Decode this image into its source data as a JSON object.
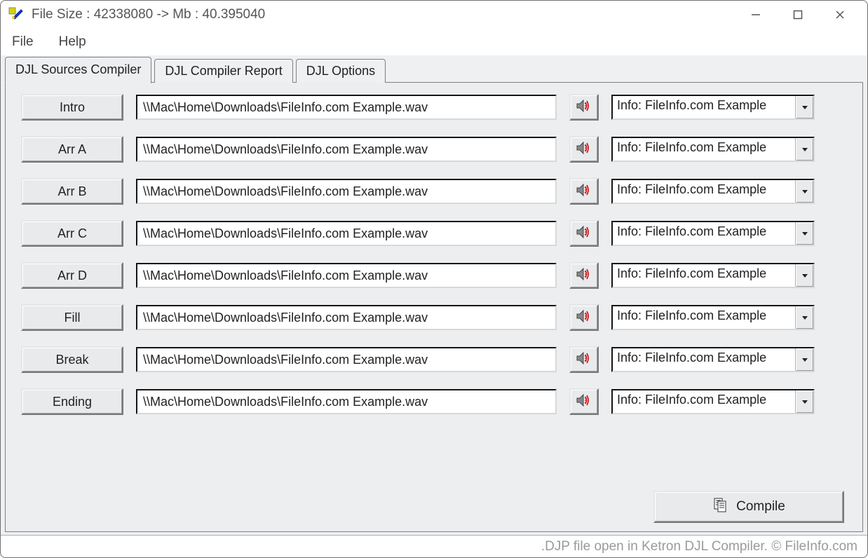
{
  "titlebar": {
    "title": "File Size : 42338080 -> Mb : 40.395040"
  },
  "menu": {
    "file": "File",
    "help": "Help"
  },
  "tabs": [
    {
      "label": "DJL Sources Compiler",
      "active": true
    },
    {
      "label": "DJL Compiler Report",
      "active": false
    },
    {
      "label": "DJL Options",
      "active": false
    }
  ],
  "rows": [
    {
      "key": "intro",
      "label": "Intro",
      "path": "\\\\Mac\\Home\\Downloads\\FileInfo.com Example.wav",
      "info": "Info: FileInfo.com Example"
    },
    {
      "key": "arr-a",
      "label": "Arr A",
      "path": "\\\\Mac\\Home\\Downloads\\FileInfo.com Example.wav",
      "info": "Info: FileInfo.com Example"
    },
    {
      "key": "arr-b",
      "label": "Arr B",
      "path": "\\\\Mac\\Home\\Downloads\\FileInfo.com Example.wav",
      "info": "Info: FileInfo.com Example"
    },
    {
      "key": "arr-c",
      "label": "Arr C",
      "path": "\\\\Mac\\Home\\Downloads\\FileInfo.com Example.wav",
      "info": "Info: FileInfo.com Example"
    },
    {
      "key": "arr-d",
      "label": "Arr D",
      "path": "\\\\Mac\\Home\\Downloads\\FileInfo.com Example.wav",
      "info": "Info: FileInfo.com Example"
    },
    {
      "key": "fill",
      "label": "Fill",
      "path": "\\\\Mac\\Home\\Downloads\\FileInfo.com Example.wav",
      "info": "Info: FileInfo.com Example"
    },
    {
      "key": "break",
      "label": "Break",
      "path": "\\\\Mac\\Home\\Downloads\\FileInfo.com Example.wav",
      "info": "Info: FileInfo.com Example"
    },
    {
      "key": "ending",
      "label": "Ending",
      "path": "\\\\Mac\\Home\\Downloads\\FileInfo.com Example.wav",
      "info": "Info: FileInfo.com Example"
    }
  ],
  "compile": {
    "label": "Compile"
  },
  "status": {
    "text": ".DJP file open in Ketron DJL Compiler. © FileInfo.com"
  }
}
